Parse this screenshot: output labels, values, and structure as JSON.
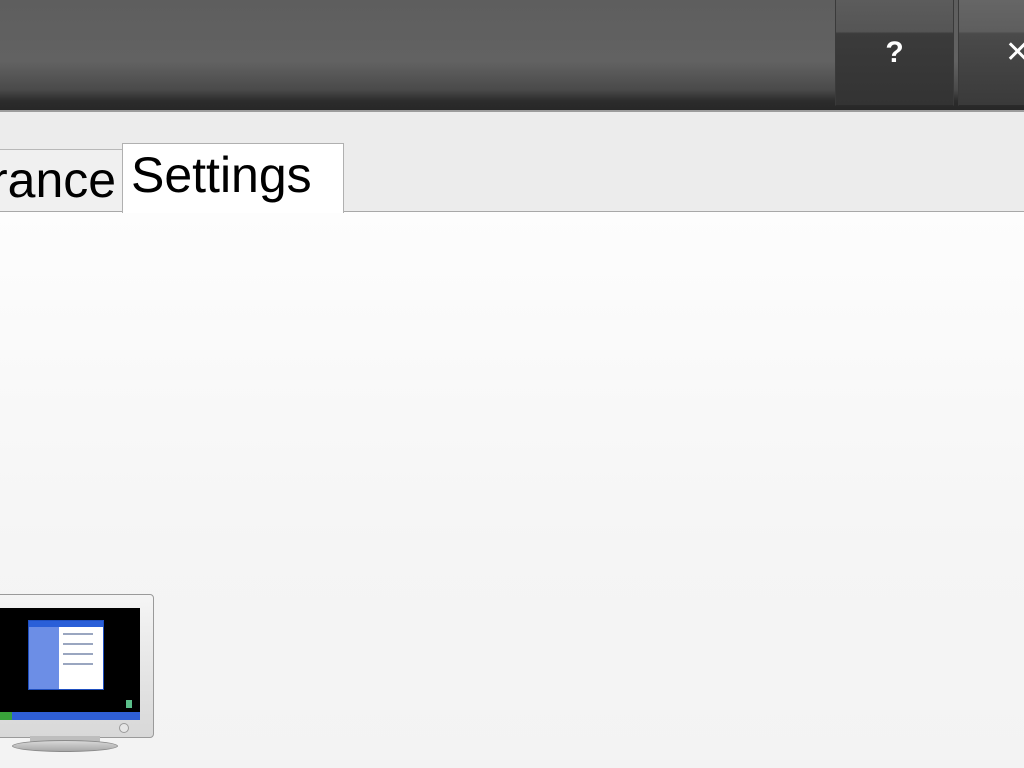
{
  "titlebar": {
    "help_label": "?",
    "close_label": "✕"
  },
  "tabs": [
    {
      "label": "Appearance",
      "visible_text": "rance",
      "selected": false
    },
    {
      "label": "Settings",
      "selected": true
    }
  ],
  "icons": {
    "help": "help-icon",
    "close": "close-icon",
    "monitor": "monitor-preview-icon"
  }
}
